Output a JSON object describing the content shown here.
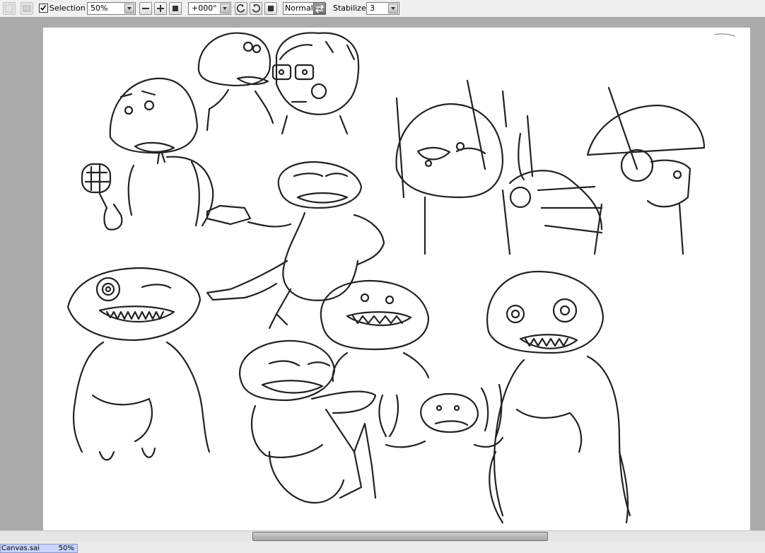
{
  "toolbar": {
    "selection_label": "Selection",
    "selection_checked": true,
    "zoom_value": "50%",
    "rotation_value": "+000°",
    "blend_mode": "Normal",
    "stabilizer_label": "Stabilizer",
    "stabilizer_value": "3",
    "icons": [
      "select-tool-icon",
      "deselect-icon",
      "zoom-out-icon",
      "zoom-in-icon",
      "zoom-reset-icon",
      "rotate-left-icon",
      "rotate-right-icon",
      "rotate-reset-icon",
      "flip-horizontal-icon"
    ]
  },
  "status_bar": {
    "document_name": "Canvas.sai",
    "document_zoom": "50%"
  },
  "colors": {
    "toolbar_bg": "#f0f0f0",
    "workspace_bg": "#ababab",
    "canvas_bg": "#ffffff",
    "ink": "#222222",
    "active_tab": "#c9d4ff"
  }
}
